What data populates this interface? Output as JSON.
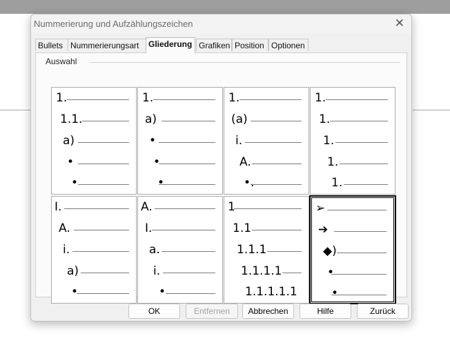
{
  "dialog": {
    "title": "Nummerierung und Aufzählungszeichen",
    "close_glyph": "✕"
  },
  "tabs": [
    {
      "label": "Bullets"
    },
    {
      "label": "Nummerierungsart"
    },
    {
      "label": "Gliederung",
      "active": true
    },
    {
      "label": "Grafiken"
    },
    {
      "label": "Position"
    },
    {
      "label": "Optionen"
    }
  ],
  "group": {
    "label": "Auswahl"
  },
  "presets": [
    [
      "1.",
      "1.1.",
      "a)",
      "•",
      "•"
    ],
    [
      "1.",
      "a)",
      "•",
      "•",
      "•"
    ],
    [
      "1.",
      "(a)",
      "i.",
      "A.",
      "•."
    ],
    [
      "1.",
      "1.",
      "1.",
      "1.",
      "1."
    ],
    [
      "I.",
      "A.",
      "i.",
      "a)",
      "•"
    ],
    [
      "A.",
      "I.",
      "a.",
      "i.",
      "•"
    ],
    [
      "1",
      "1.1",
      "1.1.1",
      "1.1.1.1",
      "1.1.1.1.1"
    ],
    [
      "➢",
      "➔",
      "◆)",
      "•",
      "•"
    ]
  ],
  "selected_preset": 7,
  "buttons": {
    "ok": "OK",
    "remove": "Entfernen",
    "cancel": "Abbrechen",
    "help": "Hilfe",
    "back": "Zurück"
  }
}
